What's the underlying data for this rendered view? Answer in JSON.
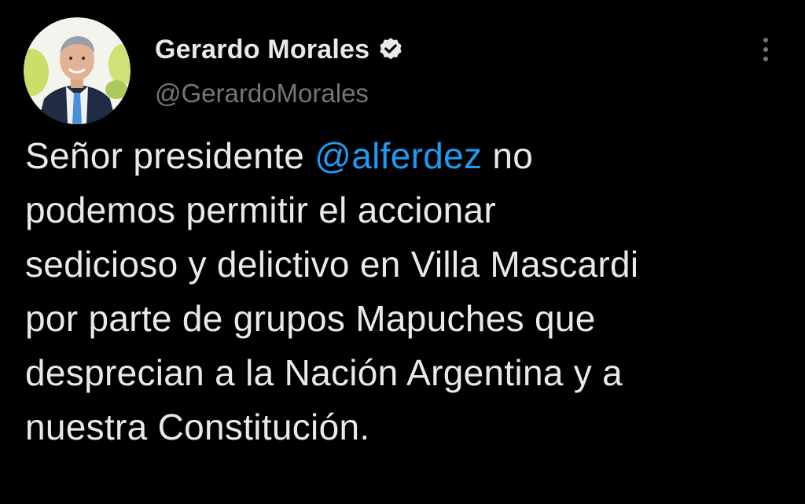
{
  "tweet": {
    "author": {
      "display_name": "Gerardo Morales",
      "handle": "@GerardoMorales",
      "verified": true,
      "avatar_icon": "profile-photo"
    },
    "text": {
      "line1_before": "Señor presidente ",
      "line1_mention": "@alferdez",
      "line1_after": " no",
      "line2": "podemos permitir el accionar",
      "line3": "sedicioso y delictivo en Villa Mascardi",
      "line4": "por parte de grupos Mapuches que",
      "line5": "desprecian a la Nación Argentina y a",
      "line6": "nuestra Constitución."
    },
    "more_icon": "vertical-ellipsis-icon"
  },
  "colors": {
    "background": "#000000",
    "text": "#e7e9ea",
    "secondary": "#71767b",
    "link": "#1d9bf0"
  }
}
